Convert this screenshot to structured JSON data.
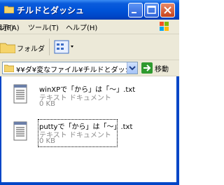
{
  "window": {
    "title": "チルドとダッシュ"
  },
  "menubar": {
    "items": [
      {
        "label": "ファイル(F)"
      },
      {
        "label": "表示(A)"
      },
      {
        "label": "ツール(T)"
      },
      {
        "label": "ヘルプ(H)"
      }
    ]
  },
  "toolbar": {
    "folders_label": "フォルダ"
  },
  "address": {
    "path": "¥¥ダ¥変なファイル¥チルドとダッシュ",
    "go_label": "移動"
  },
  "files": [
    {
      "name": "winXPで「から」は「〜」.txt",
      "type": "テキスト ドキュメント",
      "size": "0 KB"
    },
    {
      "name": "puttyで「から」は「〜」.txt",
      "type": "テキスト ドキュメント",
      "size": "0 KB"
    }
  ],
  "colors": {
    "titlebar": "#0053d8",
    "accent": "#3a8cf3",
    "close": "#c6431b",
    "go": "#2f9a2f"
  }
}
